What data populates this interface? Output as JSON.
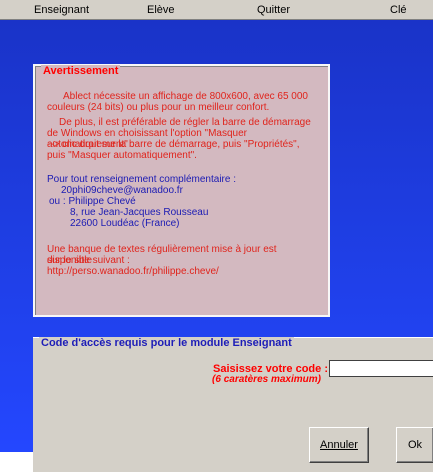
{
  "menu": {
    "items": [
      "Enseignant",
      "Elève",
      "Quitter",
      "Clé"
    ]
  },
  "warning": {
    "title": "Avertissement",
    "paragraph1": "Ablect nécessite un affichage de 800x600, avec 65 000 couleurs (24 bits) ou plus pour un meilleur confort.",
    "paragraph2": "De plus, il est préférable de régler la barre de démarrage de Windows en choisissant l'option \"Masquer automatiquement\" :",
    "paragraph3": "--> clic droit sur la barre de démarrage, puis \"Propriétés\", puis \"Masquer automatiquement\".",
    "contact_intro": "Pour tout renseignement complémentaire :",
    "email": "20phi09cheve@wanadoo.fr",
    "or_label": "ou : Philippe Chevé",
    "address_line1": "8, rue Jean-Jacques Rousseau",
    "address_line2": "22600 Loudéac (France)",
    "bank_text1": "Une banque de textes régulièrement mise à jour est disponible",
    "bank_text2": "sur le site suivant :",
    "site_url": "http://perso.wanadoo.fr/philippe.cheve/"
  },
  "access": {
    "title": "Code d'accès requis pour le module Enseignant",
    "code_label": "Saisissez votre code :",
    "code_hint": "(6 caratères maximum)",
    "code_value": "",
    "cancel_label": "Annuler",
    "ok_label": "Ok"
  },
  "colors": {
    "background_blue": "#1f3fe6",
    "warning_box": "#d3b9c0",
    "red_text": "#e0241c",
    "blue_text": "#1b1bb3",
    "panel_gray": "#d4d0c8"
  }
}
